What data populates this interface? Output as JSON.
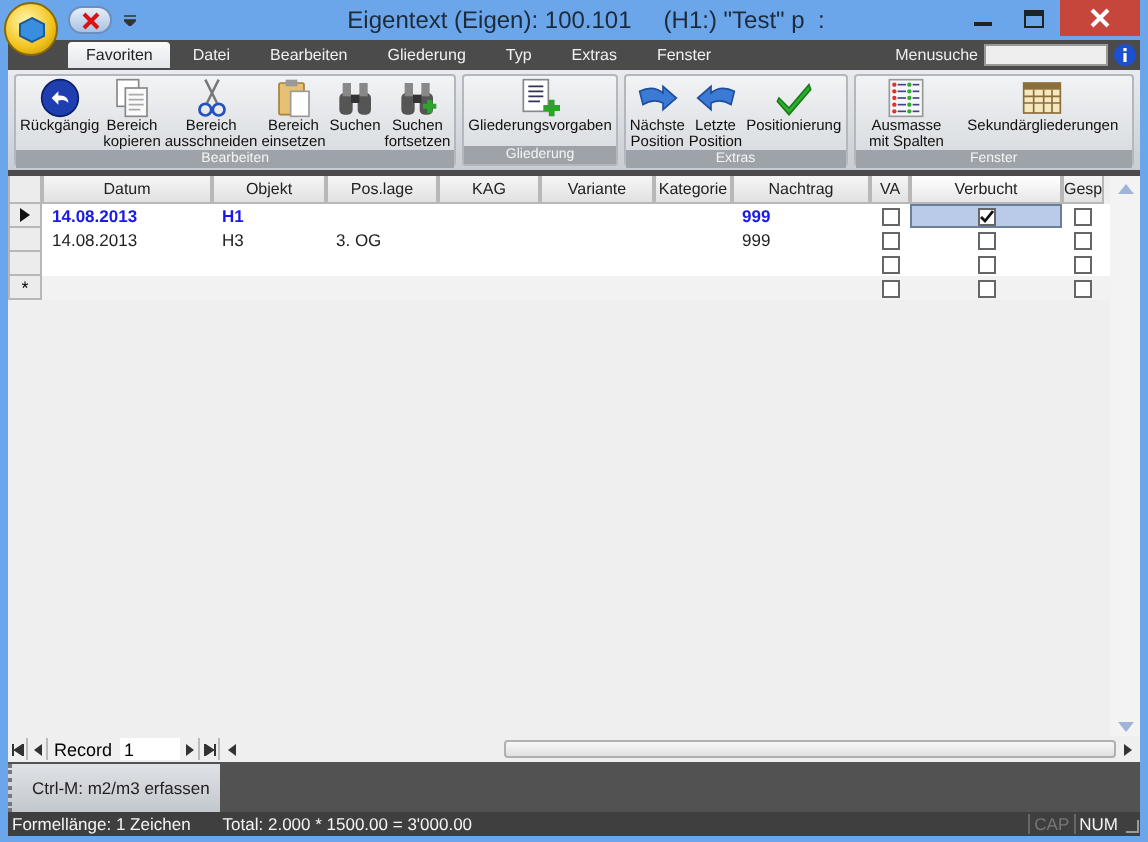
{
  "window": {
    "title": "Eigentext (Eigen): 100.101",
    "context": "(H1:) \"Test\" p  :"
  },
  "menu_tabs": [
    {
      "label": "Favoriten",
      "selected": true
    },
    {
      "label": "Datei",
      "selected": false
    },
    {
      "label": "Bearbeiten",
      "selected": false
    },
    {
      "label": "Gliederung",
      "selected": false
    },
    {
      "label": "Typ",
      "selected": false
    },
    {
      "label": "Extras",
      "selected": false
    },
    {
      "label": "Fenster",
      "selected": false
    }
  ],
  "menu_search": {
    "label": "Menusuche"
  },
  "ribbon_groups": [
    {
      "label": "Bearbeiten",
      "buttons": [
        "Rückgängig",
        "Bereich\nkopieren",
        "Bereich\nausschneiden",
        "Bereich\neinsetzen",
        "Suchen",
        "Suchen\nfortsetzen"
      ]
    },
    {
      "label": "Gliederung",
      "buttons": [
        "Gliederungsvorgaben"
      ]
    },
    {
      "label": "Extras",
      "buttons": [
        "Nächste\nPosition",
        "Letzte\nPosition",
        "Positionierung"
      ]
    },
    {
      "label": "Fenster",
      "buttons": [
        "Ausmasse\nmit Spalten",
        "Sekundärgliederungen"
      ]
    }
  ],
  "table": {
    "columns": [
      {
        "label": "Datum",
        "kind": "text"
      },
      {
        "label": "Objekt",
        "kind": "text"
      },
      {
        "label": "Pos.lage",
        "kind": "text"
      },
      {
        "label": "KAG",
        "kind": "text"
      },
      {
        "label": "Variante",
        "kind": "text"
      },
      {
        "label": "Kategorie",
        "kind": "text"
      },
      {
        "label": "Nachtrag",
        "kind": "text"
      },
      {
        "label": "VA",
        "kind": "check"
      },
      {
        "label": "Verbucht",
        "kind": "check"
      },
      {
        "label": "Gesp",
        "kind": "check"
      }
    ],
    "rows": [
      {
        "kind": "record",
        "current": true,
        "cells": [
          "14.08.2013",
          "H1",
          null,
          null,
          null,
          null,
          "999"
        ],
        "checks": [
          {
            "checked": false,
            "focused": false
          },
          {
            "checked": true,
            "focused": true
          },
          {
            "checked": false,
            "focused": false
          }
        ]
      },
      {
        "kind": "record",
        "current": false,
        "cells": [
          "14.08.2013",
          "H3",
          "3. OG",
          null,
          null,
          null,
          "999"
        ],
        "checks": [
          {
            "checked": false,
            "focused": false
          },
          {
            "checked": false,
            "focused": false
          },
          {
            "checked": false,
            "focused": false
          }
        ]
      },
      {
        "kind": "record",
        "current": false,
        "checks": [
          {
            "checked": false,
            "focused": false
          },
          {
            "checked": false,
            "focused": false
          },
          {
            "checked": false,
            "focused": false
          }
        ]
      },
      {
        "kind": "new",
        "current": false,
        "marker": "*",
        "checks": [
          {
            "checked": false,
            "focused": false
          },
          {
            "checked": false,
            "focused": false
          },
          {
            "checked": false,
            "focused": false
          }
        ]
      }
    ]
  },
  "navigator": {
    "label": "Record",
    "value": "1"
  },
  "command_button": "Ctrl-M: m2/m3 erfassen",
  "status_bar": {
    "texts": [
      "Formellänge: 1 Zeichen",
      "Total: 2.000 * 1500.00 = 3'000.00"
    ],
    "indicators": [
      {
        "label": "CAP",
        "on": false
      },
      {
        "label": "NUM",
        "on": true
      }
    ]
  }
}
